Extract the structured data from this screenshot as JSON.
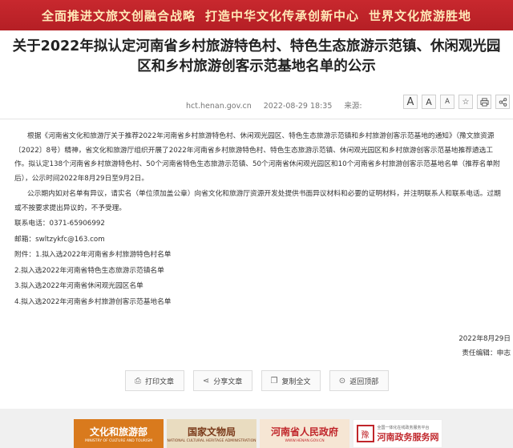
{
  "banner": {
    "segments": [
      "全面推进文旅文创融合战略",
      "打造中华文化传承创新中心",
      "世界文化旅游胜地"
    ]
  },
  "article": {
    "title": "关于2022年拟认定河南省乡村旅游特色村、特色生态旅游示范镇、休闲观光园区和乡村旅游创客示范基地名单的公示",
    "source": "hct.henan.gov.cn",
    "date": "2022-08-29 18:35",
    "source_label": "来源:",
    "paragraphs": [
      "根据《河南省文化和旅游厅关于推荐2022年河南省乡村旅游特色村、休闲观光园区、特色生态旅游示范镇和乡村旅游创客示范基地的通知》（豫文旅资源〔2022〕8号）精神，省文化和旅游厅组织开展了2022年河南省乡村旅游特色村、特色生态旅游示范镇、休闲观光园区和乡村旅游创客示范基地推荐遴选工作。拟认定138个河南省乡村旅游特色村、50个河南省特色生态旅游示范镇、50个河南省休闲观光园区和10个河南省乡村旅游创客示范基地名单（推荐名单附后），公示时间2022年8月29日至9月2日。",
      "公示期内如对名单有异议，请实名（单位须加盖公章）向省文化和旅游厅资源开发处提供书面异议材料和必要的证明材料，并注明联系人和联系电话。过期或不按要求提出异议的，不予受理。"
    ],
    "contact_phone": "联系电话：0371-65906992",
    "contact_email": "邮箱：swltzykfc@163.com",
    "attachments": [
      "附件：1.拟入选2022年河南省乡村旅游特色村名单",
      "2.拟入选2022年河南省特色生态旅游示范镇名单",
      "3.拟入选2022年河南省休闲观光园区名单",
      "4.拟入选2022年河南省乡村旅游创客示范基地名单"
    ],
    "sign_date": "2022年8月29日",
    "editor": "责任编辑：申志"
  },
  "tools": {
    "font_large": "A",
    "font_medium": "A",
    "font_small": "A",
    "icons": [
      "font-large-icon",
      "font-medium-icon",
      "font-small-icon",
      "star-icon",
      "print-icon",
      "share-icon"
    ]
  },
  "actions": {
    "print": "打印文章",
    "share": "分享文章",
    "copy": "复制全文",
    "top": "返回顶部"
  },
  "footer_logos": [
    {
      "name": "文化和旅游部",
      "sub": "MINISTRY OF CULTURE AND TOURISM"
    },
    {
      "name": "国家文物局",
      "sub": "NATIONAL CULTURAL HERITAGE ADMINISTRATION"
    },
    {
      "name": "河南省人民政府",
      "sub": "WWW.HENAN.GOV.CN"
    },
    {
      "name": "河南政务服务网",
      "sub": "全国一体化在线政务服务平台"
    }
  ],
  "colors": {
    "banner": "#c8282e",
    "banner_text": "#ffe9b8"
  }
}
